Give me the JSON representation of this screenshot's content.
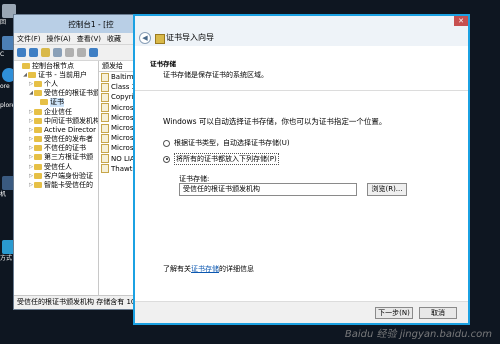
{
  "desktop": {
    "icons": [
      {
        "name": "recycle-bin-icon",
        "label": "回"
      },
      {
        "name": "computer-icon",
        "label": "C"
      },
      {
        "name": "ie-icon",
        "label": "ore"
      },
      {
        "name": "ie-label-icon",
        "label": "plore"
      },
      {
        "name": "monitor-icon",
        "label": "机"
      },
      {
        "name": "network-icon",
        "label": "方式"
      }
    ]
  },
  "mmc": {
    "title": "控制台1 - [控",
    "menu": [
      "文件(F)",
      "操作(A)",
      "查看(V)",
      "收藏"
    ],
    "tree": [
      {
        "label": "控制台根节点",
        "indent": 0,
        "arrow": ""
      },
      {
        "label": "证书 - 当前用户",
        "indent": 1,
        "arrow": "◢"
      },
      {
        "label": "个人",
        "indent": 2,
        "arrow": "▷"
      },
      {
        "label": "受信任的根证书颁",
        "indent": 2,
        "arrow": "◢"
      },
      {
        "label": "证书",
        "indent": 3,
        "arrow": "",
        "selected": true
      },
      {
        "label": "企业信任",
        "indent": 2,
        "arrow": "▷"
      },
      {
        "label": "中间证书颁发机构",
        "indent": 2,
        "arrow": "▷"
      },
      {
        "label": "Active Director",
        "indent": 2,
        "arrow": "▷"
      },
      {
        "label": "受信任的发布者",
        "indent": 2,
        "arrow": "▷"
      },
      {
        "label": "不信任的证书",
        "indent": 2,
        "arrow": "▷"
      },
      {
        "label": "第三方根证书颁",
        "indent": 2,
        "arrow": "▷"
      },
      {
        "label": "受信任人",
        "indent": 2,
        "arrow": "▷"
      },
      {
        "label": "客户端身份验证",
        "indent": 2,
        "arrow": "▷"
      },
      {
        "label": "智能卡受信任的",
        "indent": 2,
        "arrow": "▷"
      }
    ],
    "list_header": "颁发给",
    "list": [
      "Baltim",
      "Class 3",
      "Copyri",
      "Micros",
      "Micros",
      "Micros",
      "Micros",
      "Micros",
      "NO LIA",
      "Thawte"
    ],
    "status": "受信任的根证书颁发机构 存储含有 10 个"
  },
  "wizard": {
    "title": "证书导入向导",
    "close": "✕",
    "header_title": "证书存储",
    "header_desc": "证书存储是保存证书的系统区域。",
    "intro": "Windows 可以自动选择证书存储，你也可以为证书指定一个位置。",
    "option_auto": "根据证书类型，自动选择证书存储(U)",
    "option_manual": "将所有的证书都放入下列存储(P)",
    "store_label": "证书存储:",
    "store_value": "受信任的根证书颁发机构",
    "browse_label": "浏览(R)...",
    "learn_prefix": "了解有关",
    "learn_link": "证书存储",
    "learn_suffix": "的详细信息",
    "next_label": "下一步(N)",
    "cancel_label": "取消"
  },
  "watermark": "Baidu 经验 jingyan.baidu.com"
}
